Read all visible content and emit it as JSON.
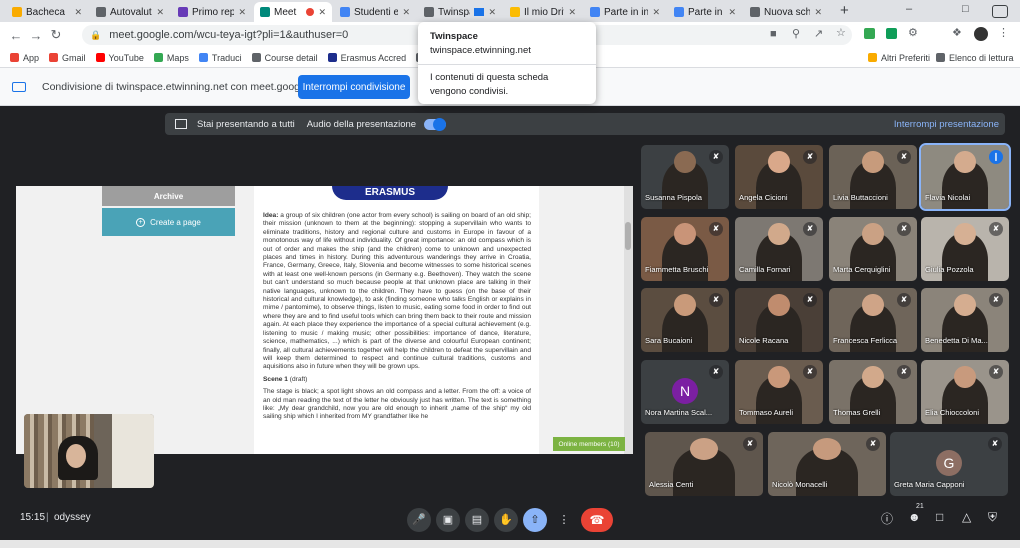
{
  "tabs": [
    {
      "title": "Bacheca",
      "color": "#f9ab00"
    },
    {
      "title": "Autovaluta",
      "color": "#5f6368"
    },
    {
      "title": "Primo rep",
      "color": "#673ab7"
    },
    {
      "title": "Meet",
      "color": "#00897b",
      "active": true
    },
    {
      "title": "Studenti e",
      "color": "#4285f4"
    },
    {
      "title": "Twinspace",
      "color": "#5f6368",
      "sharing": true
    },
    {
      "title": "Il mio Driv",
      "color": "#fbbc04"
    },
    {
      "title": "Parte in in",
      "color": "#4285f4"
    },
    {
      "title": "Parte in ita",
      "color": "#4285f4"
    },
    {
      "title": "Nuova sch",
      "color": "#5f6368"
    }
  ],
  "address_bar": {
    "url": "meet.google.com/wcu-teya-igt?pli=1&authuser=0"
  },
  "bookmarks": [
    {
      "label": "App",
      "color": "#ea4335"
    },
    {
      "label": "Gmail",
      "color": "#ea4335"
    },
    {
      "label": "YouTube",
      "color": "#ff0000"
    },
    {
      "label": "Maps",
      "color": "#34a853"
    },
    {
      "label": "Traduci",
      "color": "#4285f4"
    },
    {
      "label": "Course detail",
      "color": "#5f6368"
    },
    {
      "label": "Erasmus Accred",
      "color": "#1d2d8c"
    },
    {
      "label": "y Tool",
      "color": "#5f6368"
    }
  ],
  "bookmarks_right": {
    "other": "Altri Preferiti",
    "reading": "Elenco di lettura"
  },
  "share_bar": {
    "text": "Condivisione di twinspace.etwinning.net con meet.google.com",
    "stop_button": "Interrompi condivisione"
  },
  "tab_tooltip": {
    "title": "Twinspace",
    "domain": "twinspace.etwinning.net",
    "message": "I contenuti di questa scheda vengono condivisi."
  },
  "presenting_bar": {
    "status": "Stai presentando a tutti",
    "audio_label": "Audio della presentazione",
    "stop_label": "Interrompi presentazione"
  },
  "shared_page": {
    "archive_label": "Archive",
    "create_page_label": "Create a page",
    "banner": "ERASMUS",
    "idea_heading": "Idea:",
    "idea_text": "a group of six children (one actor from every school) is sailing on board of an old ship; their mission (unknown to them at the beginning): stopping a supervillain who wants to eliminate traditions, history and regional culture and customs in Europe in favour of a monotonous way of life without individuality. Of great importance: an old compass which is out of order and makes the ship (and the children) come to unknown and unexpected places and times in history. During this adventurous wanderings they arrive in Croatia, France, Germany, Greece, Italy, Slovenia and become witnesses to some historical scenes with at least one well-known persons (in Germany e.g. Beethoven). They watch the scene but can't understand so much because people at that unknown place are talking in their native languages, unknown to the children. They have to guess (on the base of their historical and cultural knowledge), to ask (finding someone who talks English or explains in mime / pantomime), to observe things, listen to music, eating some food in order to find out where they are and to find useful tools which can bring them back to their route and mission again. At each place they experience the importance of a special cultural achievement (e.g. listening to music / making music; other possibilities: importance of dance, literature, science, mathematics, ...) which is part of the diverse and colourful European continent; finally, all cultural achievements together will help the children to defeat the supervillain and will keep them determined to respect and continue cultural traditions, customs and aquisitions also in future when they will be grown ups.",
    "scene_heading": "Scene 1",
    "scene_tag": "(draft)",
    "scene_text": "The stage is black; a spot light shows an old compass and a letter. From the off: a voice of an old man reading the text of the letter he obviously just has written. The text is something like: „My dear grandchild, now you are old enough to inherit „name of the ship“ my old sailing ship which I inherited from MY grandfather like he",
    "online_members": "Online members (10)"
  },
  "participants": [
    {
      "name": "Susanna Pispola",
      "muted": true,
      "bg": "#3c4043",
      "skin": "#8a6a52"
    },
    {
      "name": "Angela Cicioni",
      "muted": true,
      "bg": "#5a4a3c",
      "skin": "#d9a88a"
    },
    {
      "name": "Livia Buttaccioni",
      "muted": true,
      "bg": "#6b6257",
      "skin": "#c79b7c"
    },
    {
      "name": "Flavia Nicolai",
      "muted": false,
      "speaking": true,
      "bg": "#8e8a80",
      "skin": "#d4ab8e"
    },
    {
      "name": "Fiammetta Bruschi",
      "muted": true,
      "bg": "#7a5a45",
      "skin": "#c99478"
    },
    {
      "name": "Camilla Fornari",
      "muted": true,
      "bg": "#7d7872",
      "skin": "#d1a98b"
    },
    {
      "name": "Marta Cerquiglini",
      "muted": true,
      "bg": "#8a8379",
      "skin": "#caa184"
    },
    {
      "name": "Giulia Pozzola",
      "muted": true,
      "bg": "#b9b4ac",
      "skin": "#d6b094"
    },
    {
      "name": "Sara Bucaioni",
      "muted": true,
      "bg": "#5b4d40",
      "skin": "#c99a7a"
    },
    {
      "name": "Nicole Racana",
      "muted": true,
      "bg": "#4a3f37",
      "skin": "#c08c6e"
    },
    {
      "name": "Francesca Ferlicca",
      "muted": true,
      "bg": "#6f655a",
      "skin": "#cfa487"
    },
    {
      "name": "Benedetta Di Ma...",
      "muted": true,
      "bg": "#8b847a",
      "skin": "#d5ad90"
    },
    {
      "name": "Nora Martina Scal...",
      "muted": true,
      "avatar_letter": "N",
      "avatar_color": "#7b1fa2",
      "bg": "#3c4043"
    },
    {
      "name": "Tommaso Aureli",
      "muted": true,
      "bg": "#6a5c4f",
      "skin": "#c9987a"
    },
    {
      "name": "Thomas Grelli",
      "muted": true,
      "bg": "#7a7268",
      "skin": "#d2a98b"
    },
    {
      "name": "Elia Chioccoloni",
      "muted": true,
      "bg": "#9a948b",
      "skin": "#c89a7d"
    },
    {
      "name": "Alessia Centi",
      "muted": true,
      "bg": "#5f564d",
      "skin": "#cba185"
    },
    {
      "name": "Nicolò Monacelli",
      "muted": true,
      "bg": "#6e655b",
      "skin": "#c69a7d"
    },
    {
      "name": "Greta Maria Capponi",
      "muted": true,
      "avatar_letter": "G",
      "avatar_color": "#8d6e63",
      "bg": "#3c4043"
    }
  ],
  "footer": {
    "time": "15:15",
    "meeting_name": "odyssey",
    "participant_count": "21"
  }
}
